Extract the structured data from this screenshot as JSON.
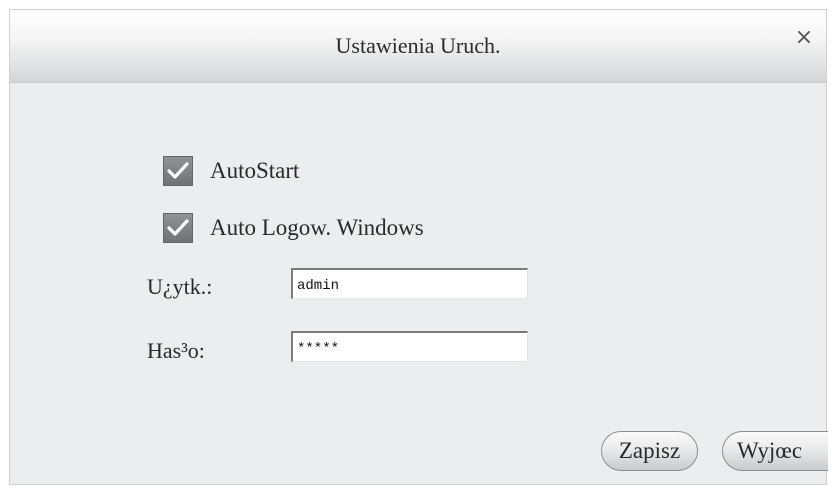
{
  "dialog": {
    "title": "Ustawienia Uruch.",
    "close_label": "×"
  },
  "options": {
    "autostart": {
      "label": "AutoStart",
      "checked": true
    },
    "auto_login": {
      "label": "Auto Logow. Windows",
      "checked": true
    }
  },
  "fields": {
    "username": {
      "label": "U¿ytk.:",
      "value": "admin"
    },
    "password": {
      "label": "Has³o:",
      "value": "*****"
    }
  },
  "buttons": {
    "save": "Zapisz",
    "exit": "Wyjœc"
  },
  "colors": {
    "dialog_bg": "#ecedee",
    "checkbox_fill": "#7f8388"
  }
}
